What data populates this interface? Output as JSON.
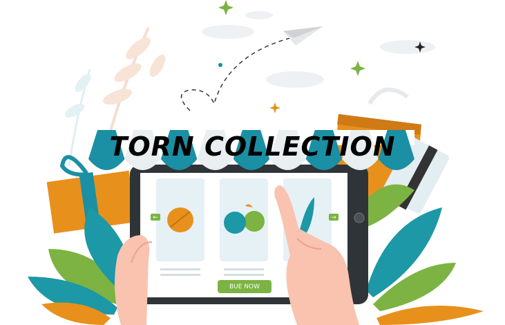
{
  "headline": "TORN COLLECTION",
  "buy_button": "BUE NOW",
  "colors": {
    "teal": "#1b8fa3",
    "orange": "#e8901c",
    "green": "#7cb342",
    "leaf_teal": "#1c98a6",
    "skin": "#f9c3b0"
  },
  "icons": [
    "left-arrow-icon",
    "right-arrow-icon",
    "home-button-icon",
    "paper-plane-icon",
    "sparkle-icon"
  ]
}
